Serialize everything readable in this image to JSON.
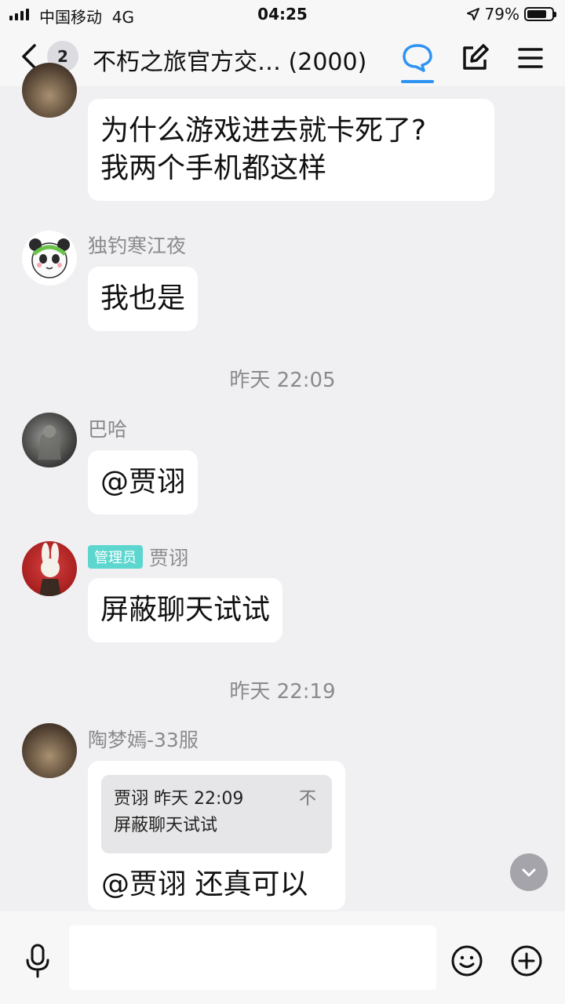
{
  "status_bar": {
    "carrier": "中国移动",
    "network": "4G",
    "time": "04:25",
    "battery": "79%",
    "battery_level": 0.79
  },
  "nav": {
    "unread_count": "2",
    "title": "不朽之旅官方交… (2000)",
    "accent_color": "#2f93f3"
  },
  "messages": [
    {
      "type": "text",
      "sender": "",
      "text_lines": [
        "为什么游戏进去就卡死了?",
        "我两个手机都这样"
      ]
    },
    {
      "type": "text",
      "sender": "独钓寒江夜",
      "text": "我也是"
    },
    {
      "type": "time",
      "text": "昨天 22:05"
    },
    {
      "type": "text",
      "sender": "巴哈",
      "text": "@贾诩"
    },
    {
      "type": "text",
      "sender": "贾诩",
      "role": "管理员",
      "text": "屏蔽聊天试试"
    },
    {
      "type": "time",
      "text": "昨天 22:19"
    },
    {
      "type": "reply",
      "sender": "陶梦嫣-33服",
      "quote": {
        "author": "贾诩",
        "time": "昨天 22:09",
        "close": "不",
        "text": "屏蔽聊天试试"
      },
      "text": "@贾诩 还真可以"
    }
  ],
  "input": {
    "placeholder": ""
  }
}
